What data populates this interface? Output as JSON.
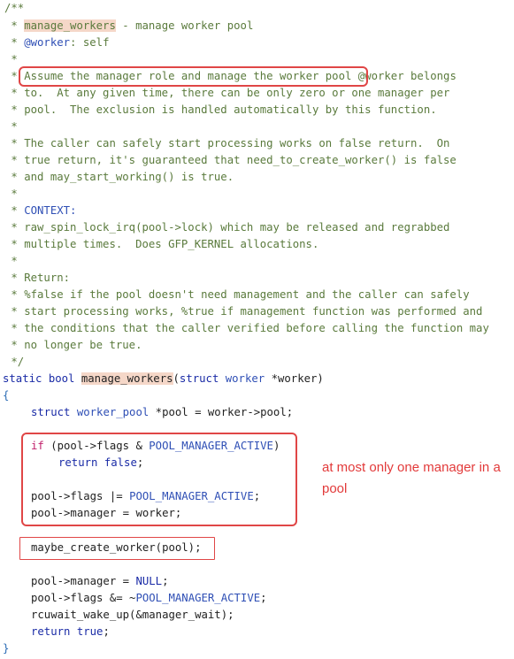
{
  "comment": {
    "open": "/**",
    "fn_name": "manage_workers",
    "fn_desc": " - manage worker pool",
    "param_tag": "@worker",
    "param_desc": ": self",
    "blank": " *",
    "assume_text": "Assume the manager role and manage the worker pool",
    "assume_rest": " @worker belongs",
    "l5": " * to.  At any given time, there can be only zero or one manager per",
    "l6": " * pool.  The exclusion is handled automatically by this function.",
    "l8": " * The caller can safely start processing works on false return.  On",
    "l9": " * true return, it's guaranteed that need_to_create_worker() is false",
    "l10": " * and may_start_working() is true.",
    "context": "CONTEXT:",
    "l13": " * raw_spin_lock_irq(pool->lock) which may be released and regrabbed",
    "l14": " * multiple times.  Does GFP_KERNEL allocations.",
    "ret": " * Return:",
    "l17": " * %false if the pool doesn't need management and the caller can safely",
    "l18": " * start processing works, %true if management function was performed and",
    "l19": " * the conditions that the caller verified before calling the function may",
    "l20": " * no longer be true.",
    "close": " */"
  },
  "code": {
    "static": "static",
    "bool": "bool",
    "fn_name": "manage_workers",
    "sig_open": "(",
    "struct": "struct",
    "worker_type": "worker",
    "param": " *worker)",
    "brace_open": "{",
    "decl_struct": "struct",
    "decl_type": "worker_pool",
    "decl_rest": " *pool = worker->pool;",
    "if_kw": "if",
    "if_cond_a": " (pool->flags & ",
    "if_const": "POOL_MANAGER_ACTIVE",
    "if_close": ")",
    "return_kw": "return",
    "false_kw": "false",
    "semi": ";",
    "flags_set_a": "pool->flags |= ",
    "flags_set_const": "POOL_MANAGER_ACTIVE",
    "flags_set_end": ";",
    "manager_set": "pool->manager = worker;",
    "maybe_create": "maybe_create_worker(pool);",
    "manager_null_a": "pool->manager = ",
    "null_kw": "NULL",
    "manager_null_end": ";",
    "flags_clear_a": "pool->flags &= ~",
    "flags_clear_const": "POOL_MANAGER_ACTIVE",
    "flags_clear_end": ";",
    "wake_up": "rcuwait_wake_up(&manager_wait);",
    "return_true_kw": "return",
    "true_kw": "true",
    "true_semi": ";",
    "brace_close": "}"
  },
  "annotation": {
    "note": "at most only one manager in a pool"
  },
  "colors": {
    "annotation_red": "#e04646",
    "comment_green": "#5a7a3c",
    "highlight": "#f5d7c8",
    "keyword_blue": "#1a2ba6"
  }
}
